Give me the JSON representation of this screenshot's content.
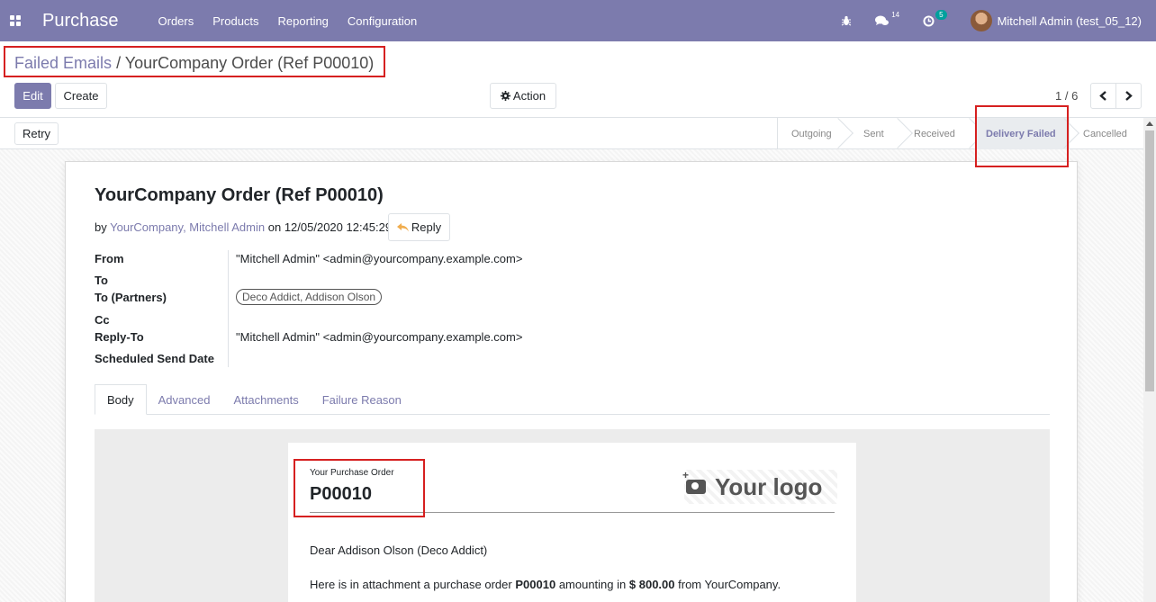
{
  "navbar": {
    "app_name": "Purchase",
    "menu": [
      "Orders",
      "Products",
      "Reporting",
      "Configuration"
    ],
    "messages_count": "14",
    "activities_count": "5",
    "user": "Mitchell Admin (test_05_12)"
  },
  "breadcrumb": {
    "parent": "Failed Emails",
    "separator": "/",
    "current": "YourCompany Order (Ref P00010)"
  },
  "toolbar": {
    "edit_label": "Edit",
    "create_label": "Create",
    "action_label": "Action",
    "pager": "1 / 6"
  },
  "statusbar": {
    "retry_label": "Retry",
    "steps": [
      "Outgoing",
      "Sent",
      "Received",
      "Delivery Failed",
      "Cancelled"
    ],
    "active_step": "Delivery Failed"
  },
  "message": {
    "subject": "YourCompany Order (Ref P00010)",
    "by_prefix": "by",
    "authors": "YourCompany, Mitchell Admin",
    "date_prefix": "on",
    "date": "12/05/2020 12:45:29",
    "reply_label": "Reply"
  },
  "fields": {
    "from_label": "From",
    "from_value": "\"Mitchell Admin\" <admin@yourcompany.example.com>",
    "to_label": "To",
    "to_partners_label": "To (Partners)",
    "to_partners_value": "Deco Addict, Addison Olson",
    "cc_label": "Cc",
    "reply_to_label": "Reply-To",
    "reply_to_value": "\"Mitchell Admin\" <admin@yourcompany.example.com>",
    "scheduled_label": "Scheduled Send Date"
  },
  "tabs": [
    "Body",
    "Advanced",
    "Attachments",
    "Failure Reason"
  ],
  "body": {
    "po_label": "Your Purchase Order",
    "po_number": "P00010",
    "logo_text": "Your logo",
    "greeting": "Dear Addison Olson (Deco Addict)",
    "line_prefix": "Here is in attachment a purchase order",
    "line_ref": "P00010",
    "line_mid": "amounting in",
    "line_amount": "$ 800.00",
    "line_suffix": "from YourCompany."
  },
  "colors": {
    "brand": "#7c7bad",
    "highlight": "#d62020"
  }
}
